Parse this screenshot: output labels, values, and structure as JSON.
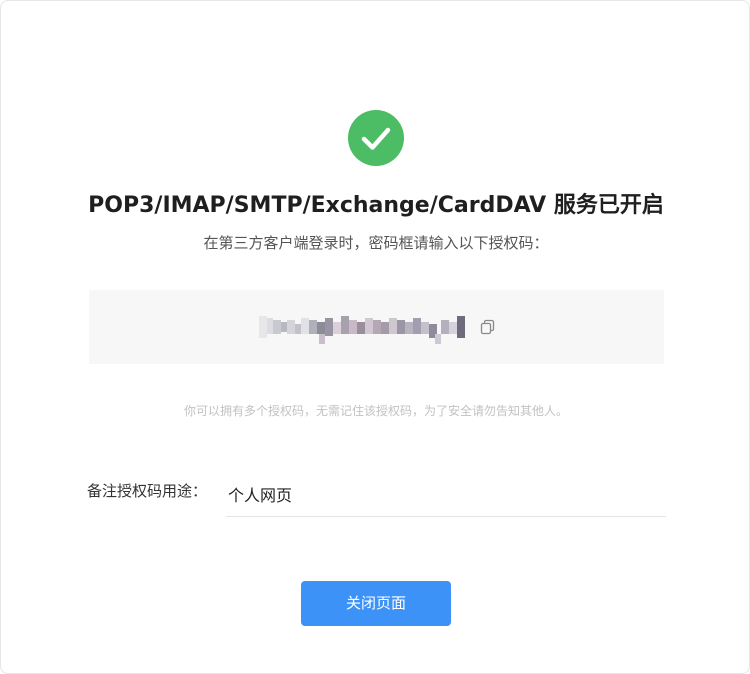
{
  "status": {
    "icon": "check-circle-icon",
    "color": "#4cbd64",
    "title": "POP3/IMAP/SMTP/Exchange/CardDAV 服务已开启",
    "subtitle": "在第三方客户端登录时，密码框请输入以下授权码："
  },
  "auth_code": {
    "display": "pixelated-redacted",
    "copy_icon": "copy-icon"
  },
  "hint": "你可以拥有多个授权码，无需记住该授权码，为了安全请勿告知其他人。",
  "note": {
    "label": "备注授权码用途：",
    "value": "个人网页"
  },
  "close_button": {
    "label": "关闭页面",
    "color": "#3c92f7"
  }
}
